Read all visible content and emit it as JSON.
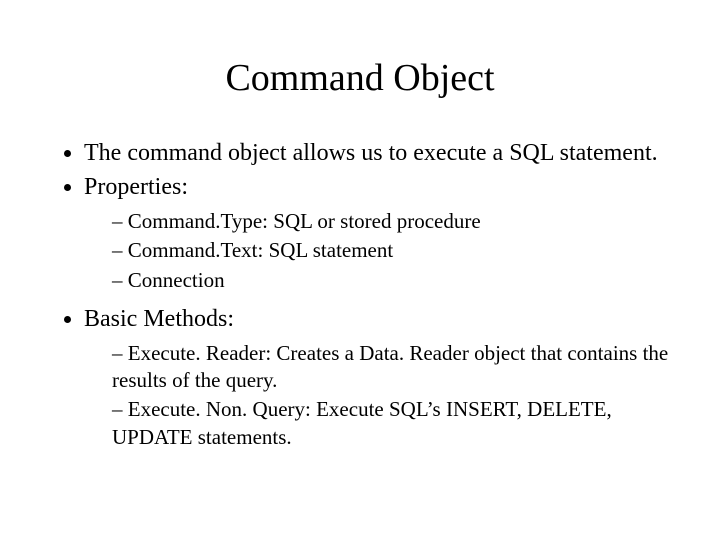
{
  "title": "Command Object",
  "bullets": {
    "b1": "The command object allows us to execute a SQL statement.",
    "b2": "Properties:",
    "b2_sub": {
      "s1": "Command.Type: SQL or stored procedure",
      "s2": "Command.Text: SQL statement",
      "s3": " Connection"
    },
    "b3": "Basic Methods:",
    "b3_sub": {
      "s1": "Execute. Reader: Creates a Data. Reader object that contains the results of the query.",
      "s2": "Execute. Non. Query: Execute SQL’s INSERT, DELETE, UPDATE statements."
    }
  }
}
